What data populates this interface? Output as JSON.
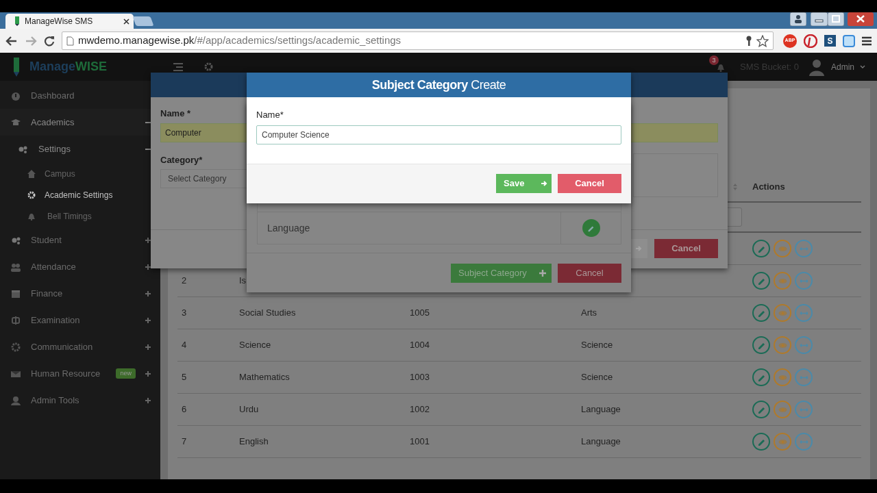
{
  "browser": {
    "tab_title": "ManageWise SMS",
    "url_host": "mwdemo.managewise.pk",
    "url_path": "/#/app/academics/settings/academic_settings",
    "extension_badge": "ABP",
    "extension_letter": "S"
  },
  "navbar": {
    "logo_first": "Manage",
    "logo_second": "WISE",
    "notification_count": "3",
    "sms_bucket": "SMS Bucket: 0",
    "user": "Admin"
  },
  "sidebar": {
    "items": [
      {
        "label": "Dashboard"
      },
      {
        "label": "Academics",
        "expanded": true,
        "children": [
          {
            "label": "Settings",
            "expanded": true,
            "children": [
              {
                "label": "Campus",
                "selected": false
              },
              {
                "label": "Academic Settings",
                "selected": true
              },
              {
                "label": "Bell Timings",
                "selected": false
              }
            ]
          }
        ]
      },
      {
        "label": "Student",
        "expanded": false
      },
      {
        "label": "Attendance",
        "expanded": false
      },
      {
        "label": "Finance",
        "expanded": false
      },
      {
        "label": "Examination",
        "expanded": false
      },
      {
        "label": "Communication",
        "expanded": false
      },
      {
        "label": "Human Resource",
        "expanded": false,
        "badge": "new"
      },
      {
        "label": "Admin Tools",
        "expanded": false
      }
    ]
  },
  "table": {
    "columns": [
      {
        "label": "Actions"
      }
    ],
    "rows": [
      {},
      {
        "number": "2",
        "subject": "Is"
      },
      {
        "number": "3",
        "subject": "Social Studies",
        "code": "1005",
        "category": "Arts"
      },
      {
        "number": "4",
        "subject": "Science",
        "code": "1004",
        "category": "Science"
      },
      {
        "number": "5",
        "subject": "Mathematics",
        "code": "1003",
        "category": "Science"
      },
      {
        "number": "6",
        "subject": "Urdu",
        "code": "1002",
        "category": "Language"
      },
      {
        "number": "7",
        "subject": "English",
        "code": "1001",
        "category": "Language"
      }
    ]
  },
  "subject_dialog": {
    "name_label": "Name *",
    "name_value": "Computer",
    "category_label": "Category*",
    "category_placeholder": "Select Category",
    "cancel": "Cancel"
  },
  "category_list_dialog": {
    "categories": [
      {
        "name": "Language"
      }
    ],
    "add_button": "Subject Category",
    "cancel": "Cancel"
  },
  "create_dialog": {
    "title": "**Subject Category** Create",
    "name_label": "Name*",
    "name_value": "Computer Science",
    "save": "Save",
    "cancel": "Cancel"
  }
}
